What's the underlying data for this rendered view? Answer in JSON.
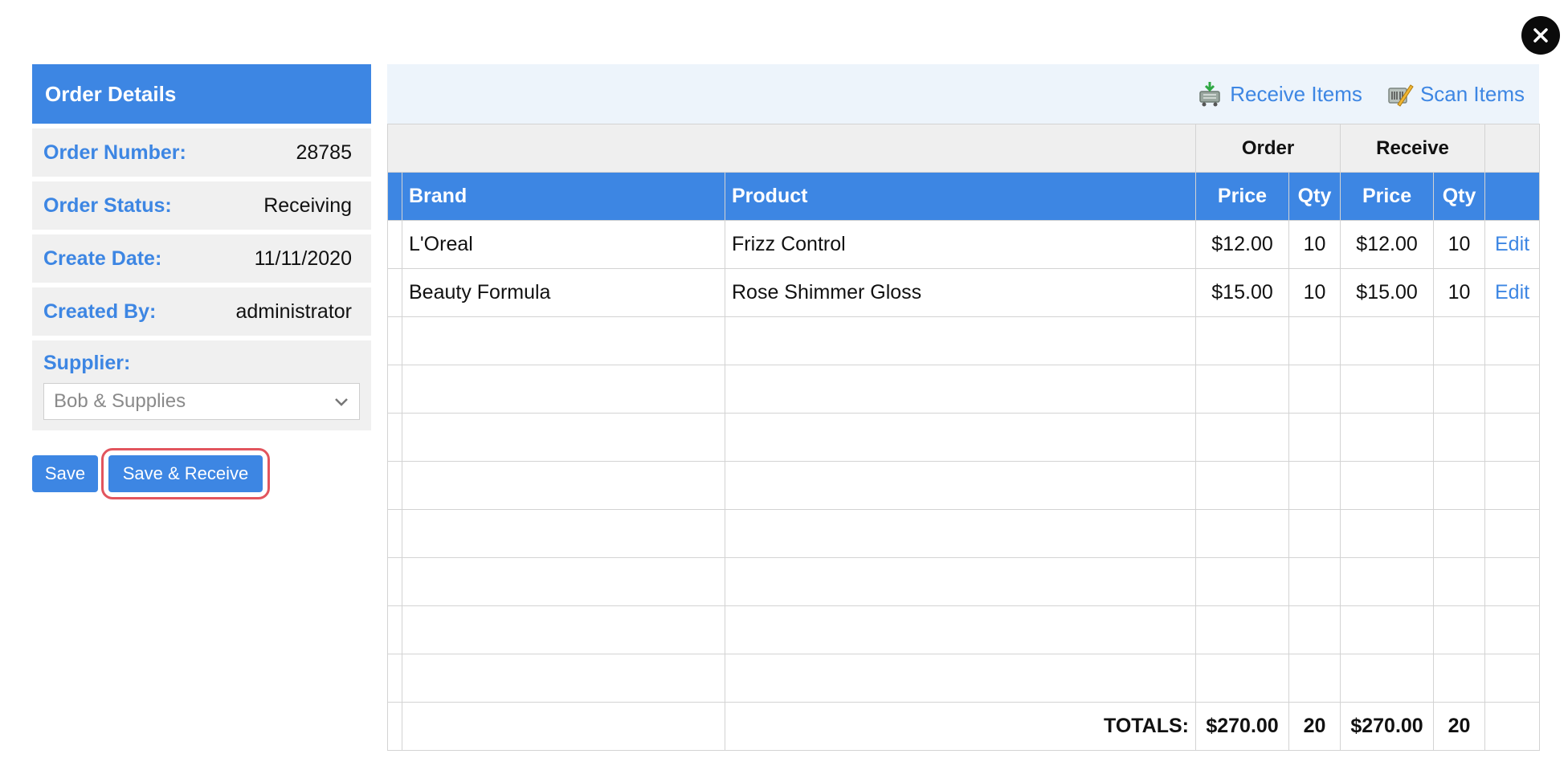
{
  "window": {
    "close_label": "close"
  },
  "order_details": {
    "title": "Order Details",
    "fields": [
      {
        "label": "Order Number:",
        "value": "28785"
      },
      {
        "label": "Order Status:",
        "value": "Receiving"
      },
      {
        "label": "Create Date:",
        "value": "11/11/2020"
      },
      {
        "label": "Created By:",
        "value": "administrator"
      }
    ],
    "supplier": {
      "label": "Supplier:",
      "selected": "Bob & Supplies"
    }
  },
  "actions": {
    "save_label": "Save",
    "save_receive_label": "Save & Receive",
    "highlight_color": "#e2555e"
  },
  "toolbar": {
    "receive_items_label": "Receive Items",
    "scan_items_label": "Scan Items"
  },
  "table": {
    "group_headers": {
      "order": "Order",
      "receive": "Receive"
    },
    "columns": {
      "brand": "Brand",
      "product": "Product",
      "order_price": "Price",
      "order_qty": "Qty",
      "receive_price": "Price",
      "receive_qty": "Qty"
    },
    "rows": [
      {
        "brand": "L'Oreal",
        "product": "Frizz Control",
        "order_price": "$12.00",
        "order_qty": "10",
        "receive_price": "$12.00",
        "receive_qty": "10",
        "action": "Edit"
      },
      {
        "brand": "Beauty Formula",
        "product": "Rose Shimmer Gloss",
        "order_price": "$15.00",
        "order_qty": "10",
        "receive_price": "$15.00",
        "receive_qty": "10",
        "action": "Edit"
      }
    ],
    "totals": {
      "label": "TOTALS:",
      "order_price": "$270.00",
      "order_qty": "20",
      "receive_price": "$270.00",
      "receive_qty": "20"
    }
  },
  "colors": {
    "accent": "#3d86e3",
    "panel_bg": "#f0f0f0",
    "toolbar_bg": "#edf4fb"
  }
}
